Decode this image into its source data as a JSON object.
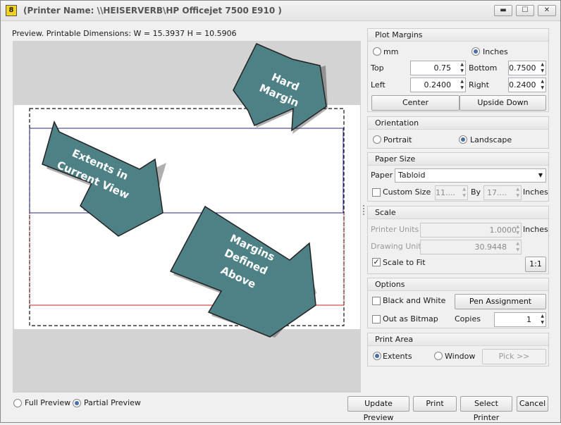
{
  "window": {
    "title": "(Printer Name: \\\\HEISERVERB\\HP Officejet 7500 E910 )",
    "app_icon_text": "8",
    "minimize_glyph": "▬",
    "maximize_glyph": "☐",
    "close_glyph": "✕"
  },
  "preview": {
    "dimensions_label": "Preview. Printable Dimensions: W = 15.3937 H = 10.5906",
    "callouts": {
      "hard_margin": [
        "Hard",
        "Margin"
      ],
      "extents": [
        "Extents in",
        "Current View"
      ],
      "margins_defined": [
        "Margins",
        "Defined",
        "Above"
      ]
    },
    "callout_color": "#4e8186",
    "extents_line_color": "#2a2a8a",
    "margin_line_color": "#cc2020"
  },
  "plot_margins": {
    "title": "Plot Margins",
    "unit_mm": "mm",
    "unit_inches": "Inches",
    "selected_unit": "Inches",
    "top_label": "Top",
    "top_value": "0.75",
    "bottom_label": "Bottom",
    "bottom_value": "0.7500",
    "left_label": "Left",
    "left_value": "0.2400",
    "right_label": "Right",
    "right_value": "0.2400",
    "center_button": "Center",
    "upside_down_button": "Upside Down"
  },
  "orientation": {
    "title": "Orientation",
    "portrait": "Portrait",
    "landscape": "Landscape",
    "selected": "Landscape"
  },
  "paper_size": {
    "title": "Paper Size",
    "paper_label": "Paper",
    "paper_value": "Tabloid",
    "custom_size_label": "Custom Size",
    "custom_checked": false,
    "width_value": "11....",
    "by_label": "By",
    "height_value": "17....",
    "unit": "Inches"
  },
  "scale": {
    "title": "Scale",
    "printer_units_label": "Printer Units",
    "printer_units_value": "1.0000",
    "printer_units_unit": "Inches",
    "drawing_units_label": "Drawing Units",
    "drawing_units_value": "30.9448",
    "scale_to_fit_label": "Scale to Fit",
    "scale_to_fit_checked": true,
    "one_to_one_button": "1:1"
  },
  "options": {
    "title": "Options",
    "black_white_label": "Black and White",
    "pen_assignment_button": "Pen Assignment",
    "out_as_bitmap_label": "Out as Bitmap",
    "copies_label": "Copies",
    "copies_value": "1"
  },
  "print_area": {
    "title": "Print Area",
    "extents": "Extents",
    "window": "Window",
    "selected": "Extents",
    "pick_button": "Pick >>"
  },
  "footer": {
    "full_preview": "Full Preview",
    "partial_preview": "Partial Preview",
    "selected_preview": "Partial Preview",
    "update_preview_button": "Update Preview",
    "print_button": "Print",
    "select_printer_button": "Select Printer",
    "cancel_button": "Cancel"
  }
}
